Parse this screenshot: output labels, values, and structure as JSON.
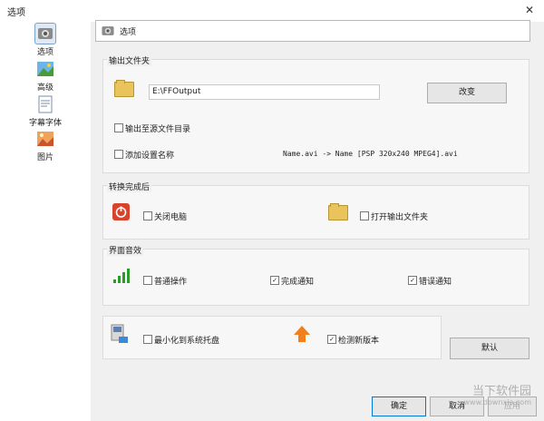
{
  "window": {
    "title": "选项",
    "close_glyph": "✕"
  },
  "sidebar": {
    "items": [
      {
        "label": "选项",
        "icon": "options-icon"
      },
      {
        "label": "高级",
        "icon": "advanced-icon"
      },
      {
        "label": "字幕字体",
        "icon": "subtitle-font-icon"
      },
      {
        "label": "图片",
        "icon": "picture-icon"
      }
    ],
    "selected": "选项"
  },
  "page": {
    "title": "选项"
  },
  "output_folder": {
    "title": "输出文件夹",
    "path": "E:\\FFOutput",
    "change_button": "改变",
    "option_source_dir": {
      "label": "输出至源文件目录",
      "checked": false
    },
    "option_add_settings": {
      "label": "添加设置名称",
      "checked": false
    },
    "example": "Name.avi -> Name [PSP 320x240 MPEG4].avi"
  },
  "after_convert": {
    "title": "转换完成后",
    "shutdown": {
      "label": "关闭电脑",
      "checked": false
    },
    "open_folder": {
      "label": "打开输出文件夹",
      "checked": false
    }
  },
  "sound": {
    "title": "界面音效",
    "normal": {
      "label": "普通操作",
      "checked": false
    },
    "complete": {
      "label": "完成通知",
      "checked": true
    },
    "error": {
      "label": "错误通知",
      "checked": true
    }
  },
  "misc": {
    "minimize_tray": {
      "label": "最小化到系统托盘",
      "checked": false
    },
    "check_update": {
      "label": "检测新版本",
      "checked": true
    }
  },
  "buttons": {
    "default": "默认",
    "ok": "确定",
    "cancel": "取消",
    "apply": "应用"
  },
  "watermark": {
    "brand": "当下软件园",
    "url": "www.downxia.com"
  },
  "colors": {
    "accent": "#d9432b",
    "folder": "#e9c35b",
    "signal": "#2e9a2e",
    "upgrade": "#f07f1c"
  }
}
